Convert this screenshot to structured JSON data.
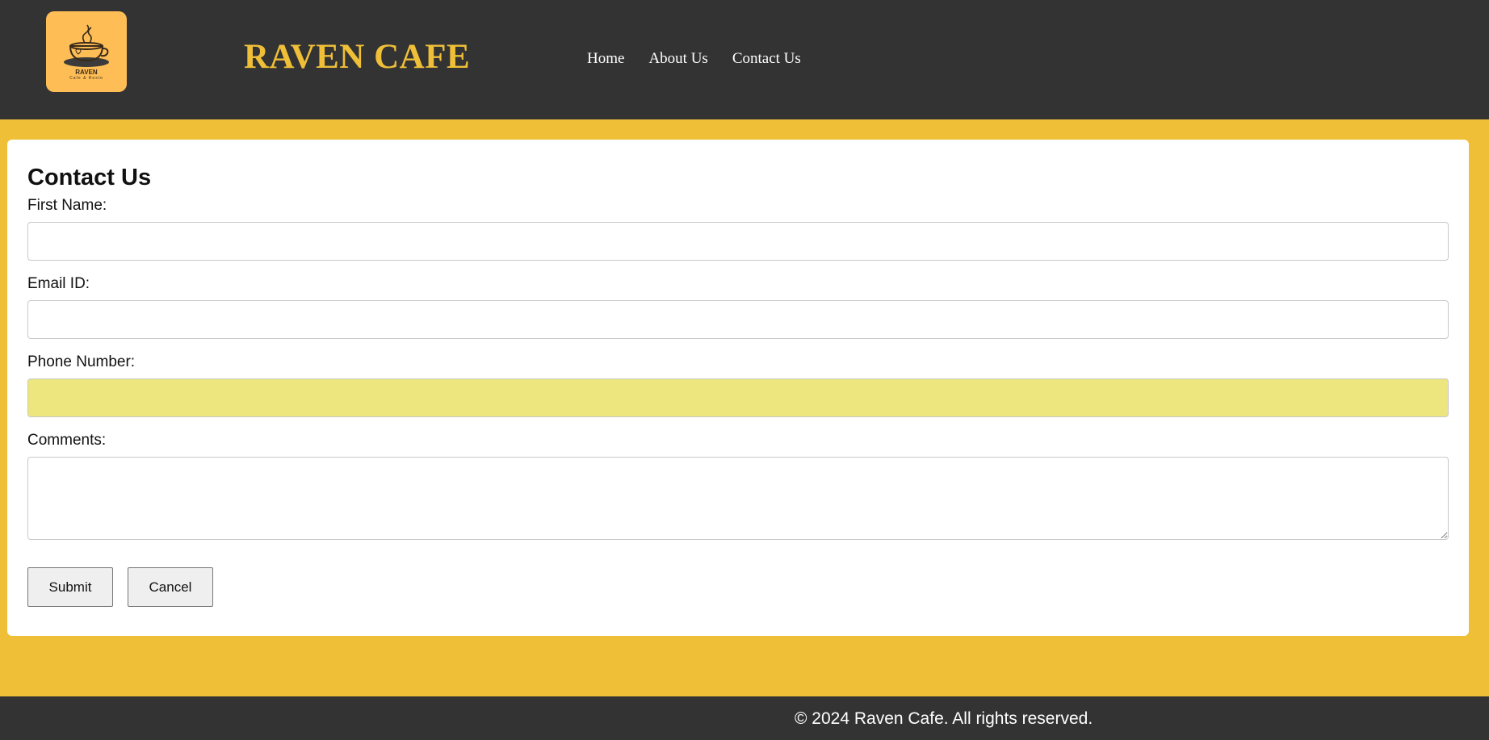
{
  "header": {
    "logo": {
      "icon": "coffee-cup-icon",
      "name": "RAVEN",
      "subtitle": "Cafe & Resto"
    },
    "brand": "RAVEN CAFE",
    "nav": [
      {
        "label": "Home"
      },
      {
        "label": "About Us"
      },
      {
        "label": "Contact Us"
      }
    ]
  },
  "form": {
    "title": "Contact Us",
    "fields": {
      "first_name": {
        "label": "First Name:",
        "value": ""
      },
      "email": {
        "label": "Email ID:",
        "value": ""
      },
      "phone": {
        "label": "Phone Number:",
        "value": ""
      },
      "comments": {
        "label": "Comments:",
        "value": ""
      }
    },
    "submit_label": "Submit",
    "cancel_label": "Cancel"
  },
  "footer": {
    "text": "© 2024 Raven Cafe. All rights reserved."
  },
  "colors": {
    "header_bg": "#333333",
    "page_bg": "#efbf38",
    "brand": "#efbf38",
    "logo_bg": "#ffbe55",
    "autofill": "#ede67f"
  }
}
